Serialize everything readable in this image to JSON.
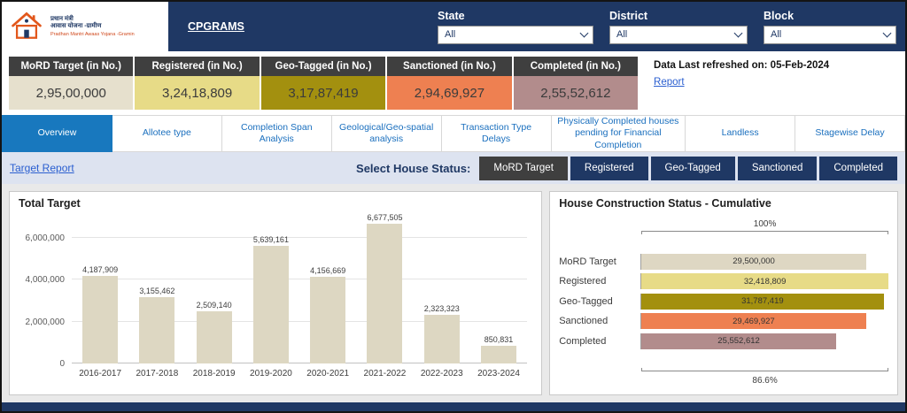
{
  "colors": {
    "navy": "#1f3864",
    "active_tab_blue": "#1878be",
    "selected_button_gray": "#3f3f3f",
    "kpi_header_gray": "#3f3f3f",
    "link_blue": "#2b5fd0",
    "status_bar_bg": "#dde3f0"
  },
  "header": {
    "cpgrams_label": "CPGRAMS",
    "logo": {
      "line1": "प्रधान मंत्री",
      "line2": "आवास योजना -ग्रामीण",
      "tagline": "Pradhan Mantri Awaas Yojana -Gramin"
    },
    "filters": [
      {
        "label": "State",
        "value": "All"
      },
      {
        "label": "District",
        "value": "All"
      },
      {
        "label": "Block",
        "value": "All"
      }
    ]
  },
  "kpi_cards": [
    {
      "label": "MoRD Target (in No.)",
      "value": "2,95,00,000",
      "bg": "#e6e0cd"
    },
    {
      "label": "Registered (in No.)",
      "value": "3,24,18,809",
      "bg": "#e7db87"
    },
    {
      "label": "Geo-Tagged (in No.)",
      "value": "3,17,87,419",
      "bg": "#a3900f"
    },
    {
      "label": "Sanctioned (in No.)",
      "value": "2,94,69,927",
      "bg": "#ee8051"
    },
    {
      "label": "Completed (in No.)",
      "value": "2,55,52,612",
      "bg": "#b28c8c"
    }
  ],
  "refresh": {
    "label": "Data Last refreshed on: 05-Feb-2024",
    "report_link": "Report"
  },
  "tabs": [
    {
      "label": "Overview",
      "active": true
    },
    {
      "label": "Allotee type",
      "active": false
    },
    {
      "label": "Completion Span Analysis",
      "active": false
    },
    {
      "label": "Geological/Geo-spatial analysis",
      "active": false
    },
    {
      "label": "Transaction Type Delays",
      "active": false
    },
    {
      "label": "Physically Completed houses pending for Financial Completion",
      "active": false
    },
    {
      "label": "Landless",
      "active": false
    },
    {
      "label": "Stagewise Delay",
      "active": false
    }
  ],
  "status_bar": {
    "target_report_link": "Target Report",
    "label": "Select House Status:",
    "buttons": [
      {
        "label": "MoRD Target",
        "selected": true
      },
      {
        "label": "Registered",
        "selected": false
      },
      {
        "label": "Geo-Tagged",
        "selected": false
      },
      {
        "label": "Sanctioned",
        "selected": false
      },
      {
        "label": "Completed",
        "selected": false
      }
    ]
  },
  "chart_data": [
    {
      "type": "bar",
      "title": "Total Target",
      "categories": [
        "2016-2017",
        "2017-2018",
        "2018-2019",
        "2019-2020",
        "2020-2021",
        "2021-2022",
        "2022-2023",
        "2023-2024"
      ],
      "values": [
        4187909,
        3155462,
        2509140,
        5639161,
        4156669,
        6677505,
        2323323,
        850831
      ],
      "labels": [
        "4,187,909",
        "3,155,462",
        "2,509,140",
        "5,639,161",
        "4,156,669",
        "6,677,505",
        "2,323,323",
        "850,831"
      ],
      "ylim": [
        0,
        7000000
      ],
      "yticks": [
        0,
        2000000,
        4000000,
        6000000
      ],
      "ytick_labels": [
        "0",
        "2,000,000",
        "4,000,000",
        "6,000,000"
      ],
      "bar_color": "#ddd7c2",
      "grid": true,
      "legend": "none"
    },
    {
      "type": "bar",
      "orientation": "horizontal",
      "title": "House Construction Status - Cumulative",
      "categories": [
        "MoRD Target",
        "Registered",
        "Geo-Tagged",
        "Sanctioned",
        "Completed"
      ],
      "values": [
        29500000,
        32418809,
        31787419,
        29469927,
        25552612
      ],
      "labels": [
        "29,500,000",
        "32,418,809",
        "31,787,419",
        "29,469,927",
        "25,552,612"
      ],
      "colors": [
        "#ded7c3",
        "#e7db87",
        "#a3900f",
        "#ee8051",
        "#b28c8c"
      ],
      "xlim": [
        0,
        32418809
      ],
      "annotations": {
        "top": "100%",
        "bottom": "86.6%"
      },
      "legend": "none"
    }
  ]
}
